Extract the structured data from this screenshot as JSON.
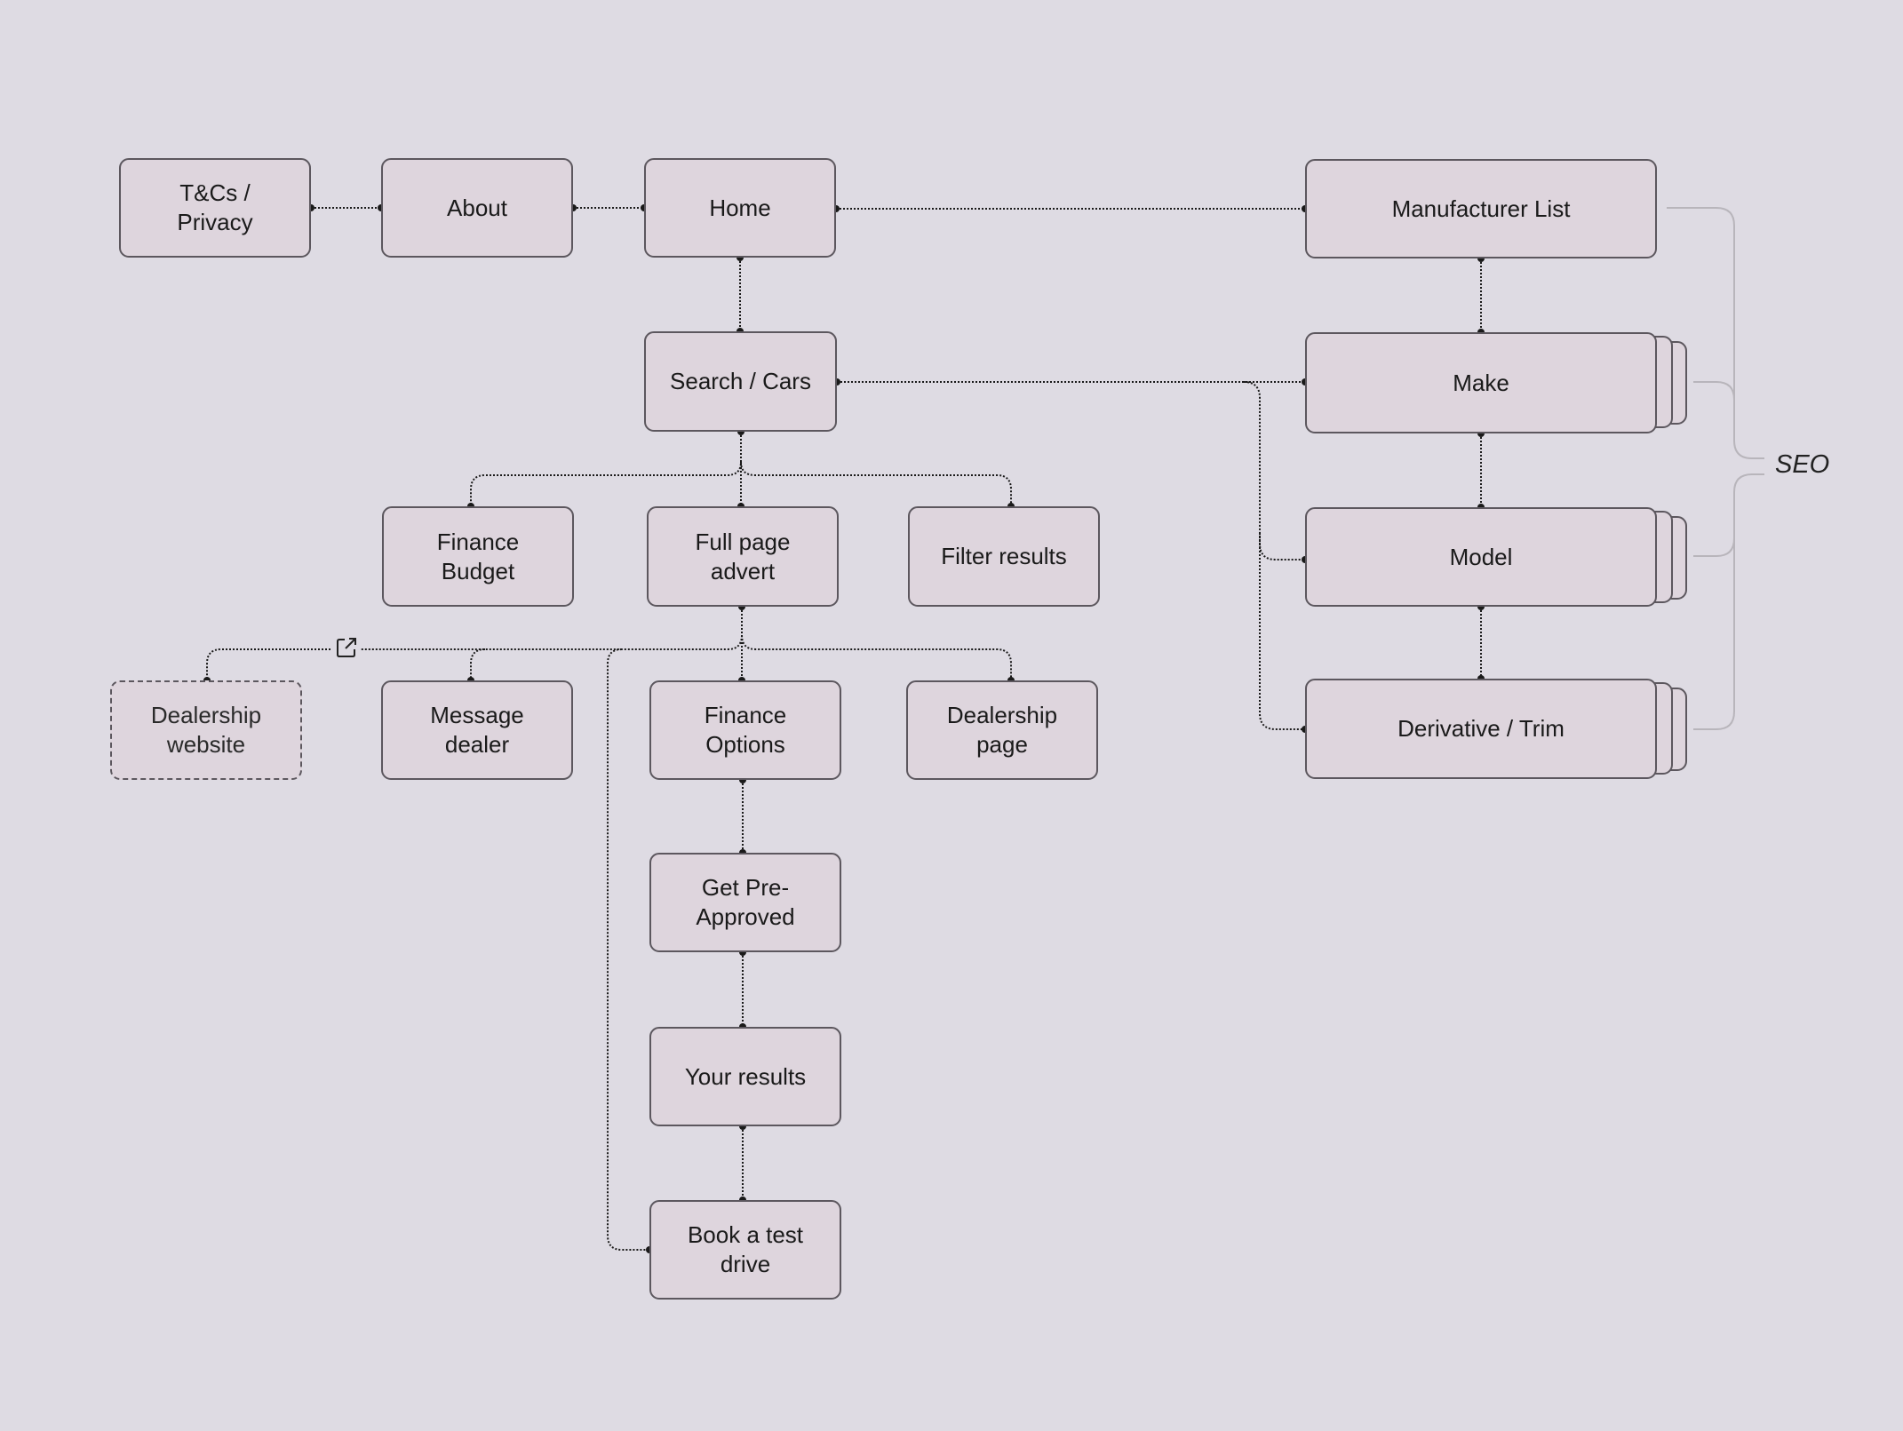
{
  "nodes": {
    "terms": "T&Cs / Privacy",
    "about": "About",
    "home": "Home",
    "manufacturer_list": "Manufacturer List",
    "search_cars": "Search / Cars",
    "make": "Make",
    "model": "Model",
    "derivative": "Derivative / Trim",
    "finance_budget": "Finance Budget",
    "full_page_advert": "Full page advert",
    "filter_results": "Filter results",
    "dealership_website": "Dealership website",
    "message_dealer": "Message dealer",
    "finance_options": "Finance Options",
    "dealership_page": "Dealership page",
    "get_pre_approved": "Get Pre-Approved",
    "your_results": "Your results",
    "book_test_drive": "Book a test drive"
  },
  "seo_label": "SEO",
  "icons": {
    "external": "external-link-icon"
  },
  "colors": {
    "background": "#dedbe3",
    "node_fill": "#ded5dd",
    "node_border": "#5c575e",
    "connector": "#1a1a1a",
    "seo_bracket": "#b8b5bb"
  }
}
